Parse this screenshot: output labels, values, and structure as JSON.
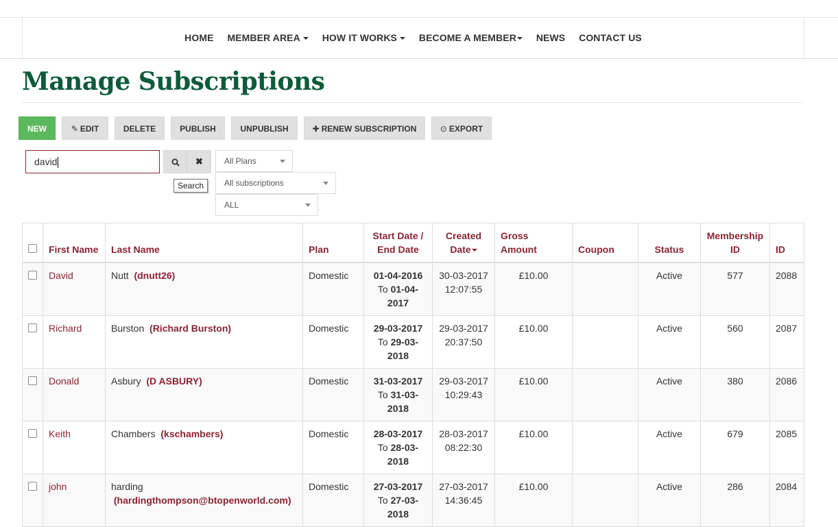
{
  "nav": {
    "items": [
      "HOME",
      "MEMBER AREA",
      "HOW IT WORKS",
      "BECOME A MEMBER",
      "NEWS",
      "CONTACT US"
    ]
  },
  "page": {
    "title": "Manage Subscriptions"
  },
  "toolbar": {
    "new": "NEW",
    "edit": "EDIT",
    "delete": "DELETE",
    "publish": "PUBLISH",
    "unpublish": "UNPUBLISH",
    "renew": "RENEW SUBSCRIPTION",
    "export": "EXPORT"
  },
  "search": {
    "value": "david",
    "tooltip": "Search"
  },
  "filters": {
    "plan": "All Plans",
    "subscriptions": "All subscriptions",
    "status": "ALL"
  },
  "table": {
    "headers": {
      "first_name": "First Name",
      "last_name": "Last Name",
      "plan": "Plan",
      "dates_1": "Start Date /",
      "dates_2": "End Date",
      "created_1": "Created",
      "created_2": "Date",
      "gross_1": "Gross",
      "gross_2": "Amount",
      "coupon": "Coupon",
      "status": "Status",
      "membership_1": "Membership",
      "membership_2": "ID",
      "id": "ID"
    },
    "rows": [
      {
        "first": "David",
        "last": "Nutt",
        "user": "(dnutt26)",
        "plan": "Domestic",
        "start": "01-04-2016",
        "to_label": "To",
        "end_a": "01-04-",
        "end_b": "2017",
        "created_date": "30-03-2017",
        "created_time": "12:07:55",
        "gross": "£10.00",
        "coupon": "",
        "status": "Active",
        "membership_id": "577",
        "id": "2088"
      },
      {
        "first": "Richard",
        "last": "Burston",
        "user": "(Richard Burston)",
        "plan": "Domestic",
        "start": "29-03-2017",
        "to_label": "To",
        "end_a": "29-03-",
        "end_b": "2018",
        "created_date": "29-03-2017",
        "created_time": "20:37:50",
        "gross": "£10.00",
        "coupon": "",
        "status": "Active",
        "membership_id": "560",
        "id": "2087"
      },
      {
        "first": "Donald",
        "last": "Asbury",
        "user": "(D ASBURY)",
        "plan": "Domestic",
        "start": "31-03-2017",
        "to_label": "To",
        "end_a": "31-03-",
        "end_b": "2018",
        "created_date": "29-03-2017",
        "created_time": "10:29:43",
        "gross": "£10.00",
        "coupon": "",
        "status": "Active",
        "membership_id": "380",
        "id": "2086"
      },
      {
        "first": "Keith",
        "last": "Chambers",
        "user": "(kschambers)",
        "plan": "Domestic",
        "start": "28-03-2017",
        "to_label": "To",
        "end_a": "28-03-",
        "end_b": "2018",
        "created_date": "28-03-2017",
        "created_time": "08:22:30",
        "gross": "£10.00",
        "coupon": "",
        "status": "Active",
        "membership_id": "679",
        "id": "2085"
      },
      {
        "first": "john",
        "last": "harding",
        "user": "(hardingthompson@btopenworld.com)",
        "plan": "Domestic",
        "start": "27-03-2017",
        "to_label": "To",
        "end_a": "27-03-",
        "end_b": "2018",
        "created_date": "27-03-2017",
        "created_time": "14:36:45",
        "gross": "£10.00",
        "coupon": "",
        "status": "Active",
        "membership_id": "286",
        "id": "2084"
      }
    ]
  }
}
